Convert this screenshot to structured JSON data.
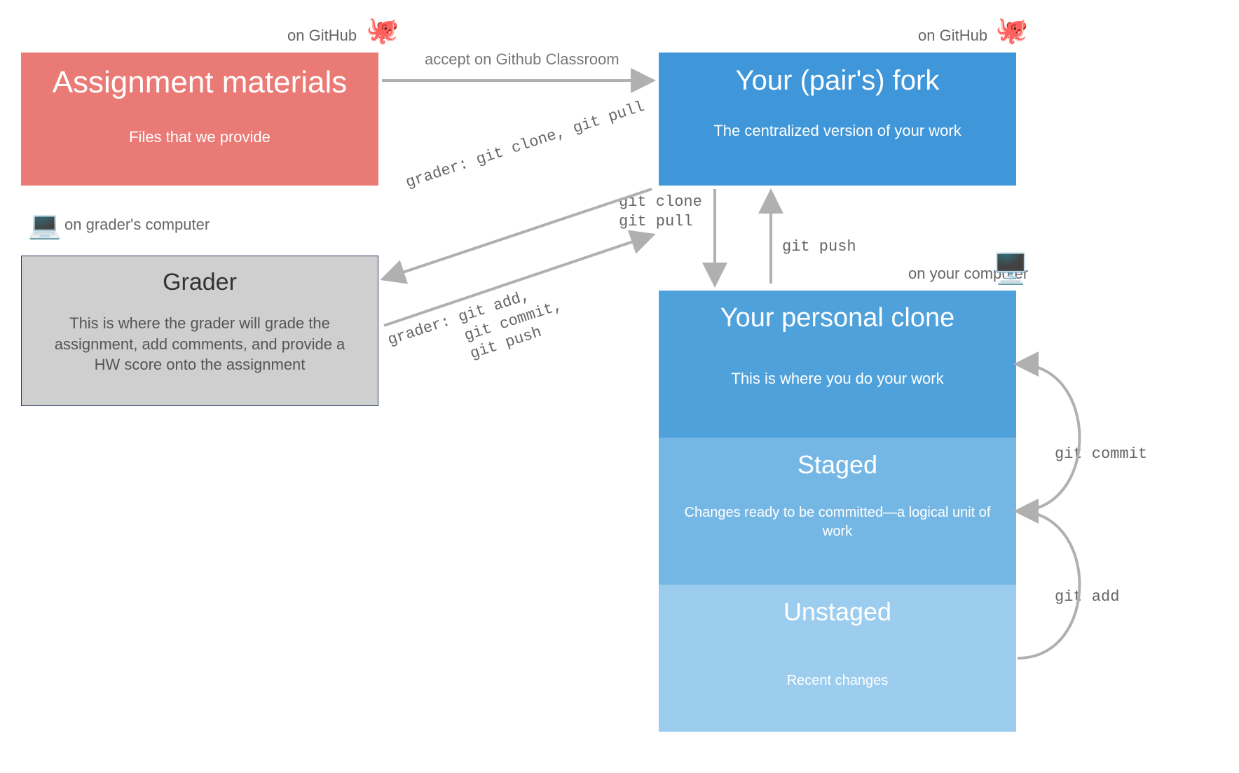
{
  "captions": {
    "assign_github": "on GitHub",
    "fork_github": "on GitHub",
    "grader_computer": "on grader's computer",
    "clone_computer": "on your computer"
  },
  "boxes": {
    "assignment": {
      "title": "Assignment materials",
      "subtitle": "Files that we provide"
    },
    "fork": {
      "title": "Your (pair's) fork",
      "subtitle": "The centralized version of your work"
    },
    "grader": {
      "title": "Grader",
      "subtitle": "This is where the grader will grade the assignment, add comments, and provide a HW score onto the assignment"
    },
    "clone": {
      "title": "Your personal clone",
      "subtitle": "This is where you do your work"
    },
    "staged": {
      "title": "Staged",
      "subtitle": "Changes ready to be committed—a logical unit of work"
    },
    "unstaged": {
      "title": "Unstaged",
      "subtitle": "Recent changes"
    }
  },
  "edges": {
    "accept": "accept on Github Classroom",
    "clone_pull": "git clone\ngit pull",
    "push": "git push",
    "grader_pull": "grader: git clone, git pull",
    "grader_push": "grader: git add,\n        git commit,\n        git push",
    "git_commit": "git commit",
    "git_add": "git add"
  },
  "icons": {
    "octocat": "🐙",
    "laptop": "💻",
    "desktop": "🖥️"
  },
  "colors": {
    "assignment": "#ea7a76",
    "fork": "#3f96d9",
    "clone": "#4fa1db",
    "staged": "#75b7e4",
    "unstaged": "#9ccdee",
    "grader": "#cfcfcf",
    "arrow": "#b0b0b0"
  }
}
